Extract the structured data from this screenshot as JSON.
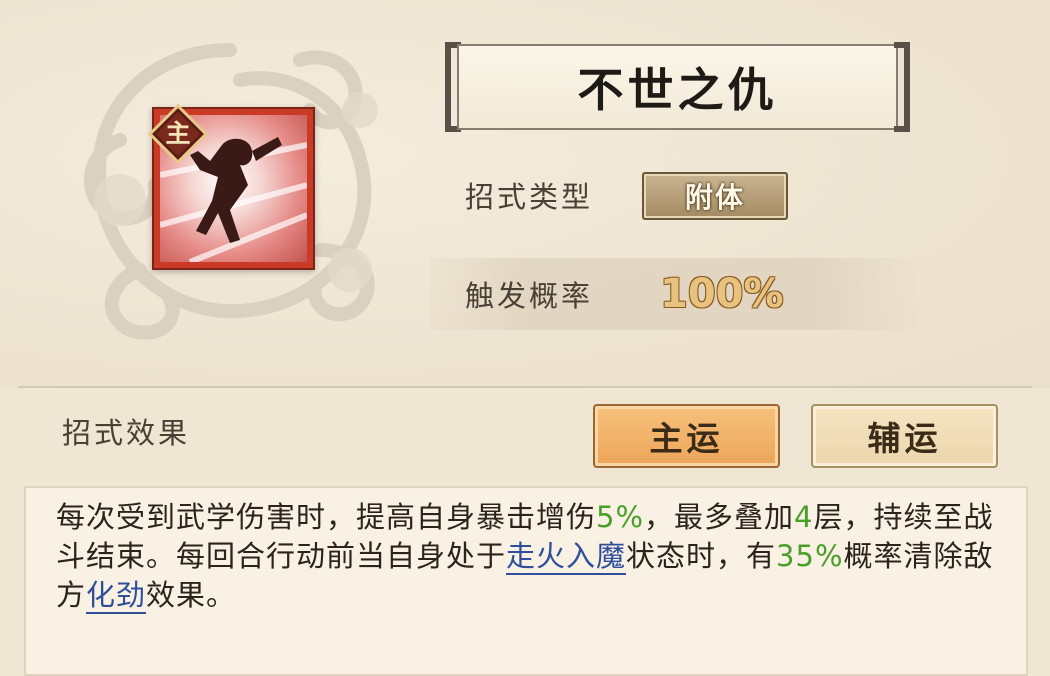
{
  "skill": {
    "name": "不世之仇",
    "badge": "主",
    "type_label": "招式类型",
    "type_value": "附体",
    "rate_label": "触发概率",
    "rate_value": "100%"
  },
  "effects": {
    "label": "招式效果",
    "tabs": [
      {
        "label": "主运",
        "active": true
      },
      {
        "label": "辅运",
        "active": false
      }
    ],
    "description": [
      {
        "text": "每次受到武学伤害时，提高自身暴击增伤",
        "style": "plain"
      },
      {
        "text": "5%",
        "style": "green"
      },
      {
        "text": "，最多叠加",
        "style": "plain"
      },
      {
        "text": "4",
        "style": "green"
      },
      {
        "text": "层，持续至战斗结束。每回合行动前当自身处于",
        "style": "plain"
      },
      {
        "text": "走火入魔",
        "style": "link"
      },
      {
        "text": "状态时，有",
        "style": "plain"
      },
      {
        "text": "35%",
        "style": "green"
      },
      {
        "text": "概率清除敌方",
        "style": "plain"
      },
      {
        "text": "化劲",
        "style": "link"
      },
      {
        "text": "效果。",
        "style": "plain"
      }
    ]
  },
  "colors": {
    "accent_tab": "#eda55a",
    "green_value": "#4a9e2a",
    "link_blue": "#2f4f9a",
    "icon_frame": "#c93a27"
  },
  "icons": [
    "cloud-emblem",
    "skill-figure",
    "main-badge-diamond"
  ]
}
